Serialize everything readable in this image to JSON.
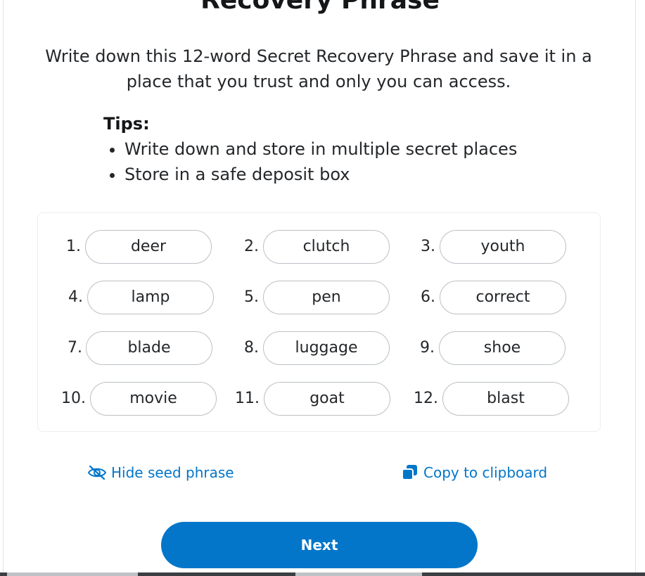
{
  "header": {
    "title": "Recovery Phrase"
  },
  "intro": {
    "text": "Write down this 12-word Secret Recovery Phrase and save it in a place that you trust and only you can access."
  },
  "tips": {
    "heading": "Tips:",
    "items": [
      "Write down and store in multiple secret places",
      "Store in a safe deposit box"
    ]
  },
  "phrase": {
    "words": [
      {
        "num": "1.",
        "word": "deer"
      },
      {
        "num": "2.",
        "word": "clutch"
      },
      {
        "num": "3.",
        "word": "youth"
      },
      {
        "num": "4.",
        "word": "lamp"
      },
      {
        "num": "5.",
        "word": "pen"
      },
      {
        "num": "6.",
        "word": "correct"
      },
      {
        "num": "7.",
        "word": "blade"
      },
      {
        "num": "8.",
        "word": "luggage"
      },
      {
        "num": "9.",
        "word": "shoe"
      },
      {
        "num": "10.",
        "word": "movie"
      },
      {
        "num": "11.",
        "word": "goat"
      },
      {
        "num": "12.",
        "word": "blast"
      }
    ]
  },
  "actions": {
    "hide_label": "Hide seed phrase",
    "hide_icon": "eye-slash-icon",
    "copy_label": "Copy to clipboard",
    "copy_icon": "copy-icon"
  },
  "footer": {
    "next_label": "Next"
  },
  "colors": {
    "accent": "#0376c9",
    "text": "#24272a",
    "pill_border": "#bbc0c5"
  }
}
